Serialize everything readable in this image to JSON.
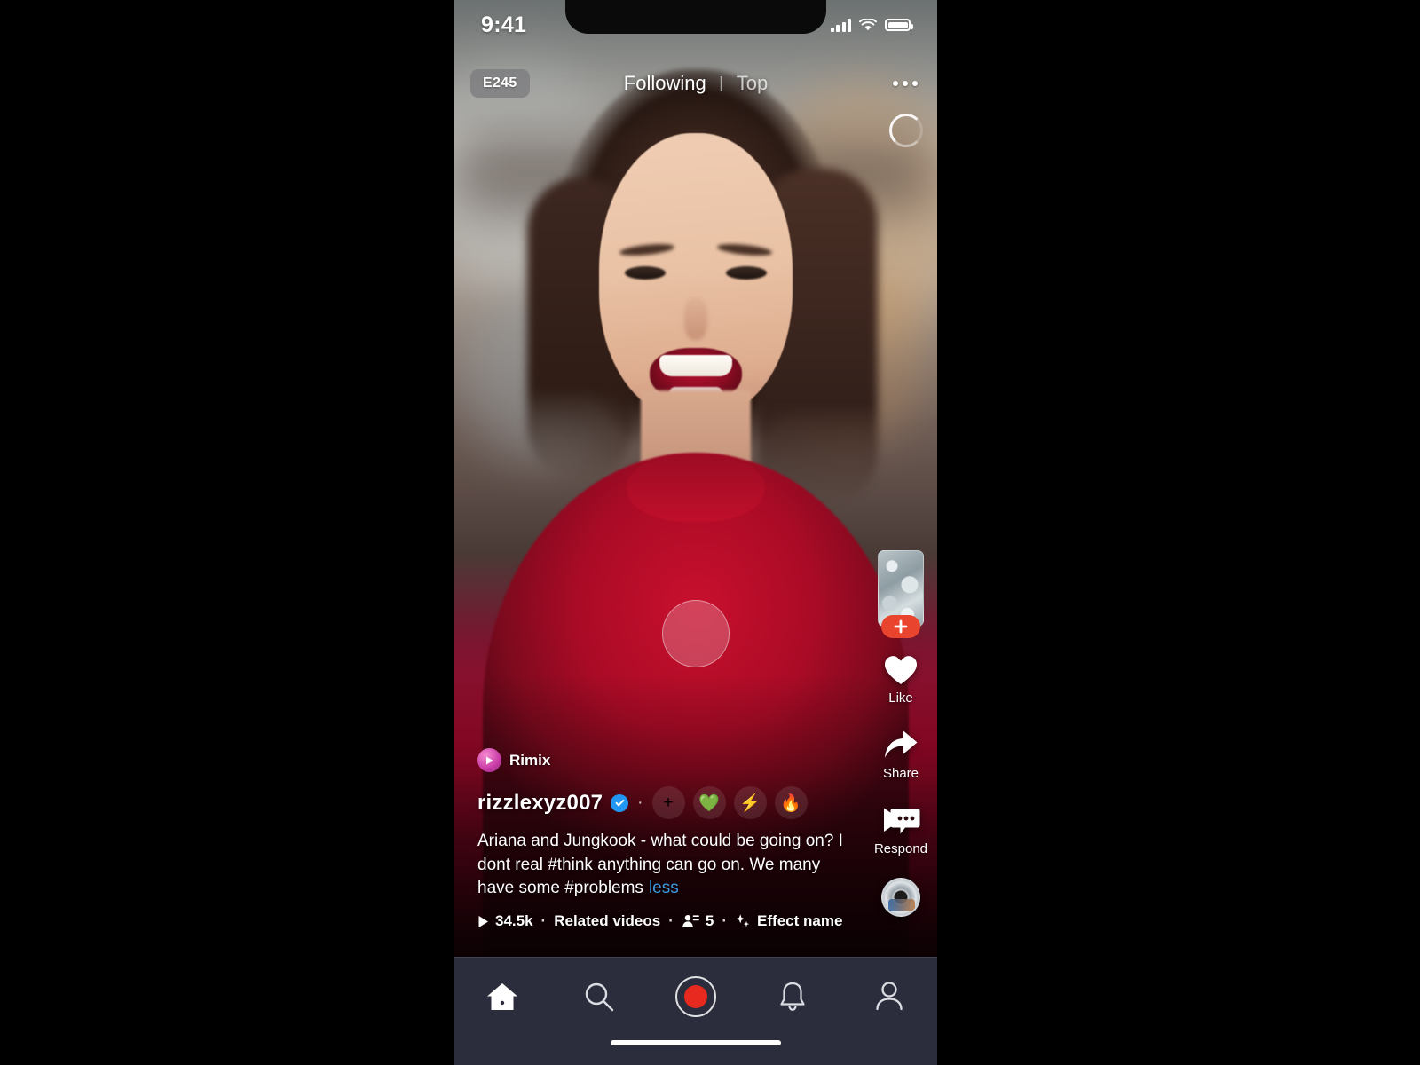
{
  "status_bar": {
    "time": "9:41",
    "signal_icon": "cellular-bars-icon",
    "wifi_icon": "wifi-icon",
    "battery_icon": "battery-icon"
  },
  "top_bar": {
    "episode_badge": "E245",
    "tabs": [
      {
        "label": "Following",
        "active": true
      },
      {
        "label": "Top",
        "active": false
      }
    ],
    "more_icon": "more-options-icon"
  },
  "video": {
    "loading_spinner_icon": "loading-spinner-icon",
    "tap_indicator_icon": "tap-indicator-circle"
  },
  "action_rail": {
    "profile_thumbnail_icon": "profile-thumbnail",
    "follow_label": "+",
    "items": [
      {
        "icon": "heart-icon",
        "label": "Like"
      },
      {
        "icon": "share-arrow-icon",
        "label": "Share"
      },
      {
        "icon": "video-respond-icon",
        "label": "Respond"
      }
    ],
    "sound_disc_icon": "sound-disc-icon"
  },
  "post": {
    "remix_badge": {
      "label": "Rimix",
      "icon": "remix-play-icon"
    },
    "username": "rizzlexyz007",
    "verified_icon": "verified-check-icon",
    "separator": "·",
    "chips": [
      {
        "name": "add-chip",
        "glyph": "+"
      },
      {
        "name": "gem-chip",
        "glyph": "💚"
      },
      {
        "name": "lightning-chip",
        "glyph": "⚡"
      },
      {
        "name": "fire-chip",
        "glyph": "🔥"
      }
    ],
    "caption": "Ariana and Jungkook - what could be going on? I dont real #think anything can go on. We many have some #problems",
    "caption_toggle": "less",
    "meta": {
      "play_icon": "play-icon",
      "play_count": "34.5k",
      "related_label": "Related videos",
      "collab_icon": "collaborators-icon",
      "collab_count": "5",
      "effect_icon": "sparkle-effect-icon",
      "effect_name": "Effect name",
      "dot": "·"
    }
  },
  "bottom_nav": {
    "items": [
      {
        "name": "nav-home",
        "icon": "home-icon",
        "active": true
      },
      {
        "name": "nav-search",
        "icon": "search-icon",
        "active": false
      },
      {
        "name": "nav-record",
        "icon": "record-button-icon",
        "active": false
      },
      {
        "name": "nav-notifications",
        "icon": "bell-icon",
        "active": false
      },
      {
        "name": "nav-profile",
        "icon": "person-icon",
        "active": false
      }
    ],
    "home_indicator": "home-indicator"
  },
  "colors": {
    "accent_red": "#e8291f",
    "follow_red": "#e8442e",
    "verified_blue": "#2196f3",
    "link_blue": "#3b9ae1",
    "nav_background": "#2b2d3c"
  }
}
